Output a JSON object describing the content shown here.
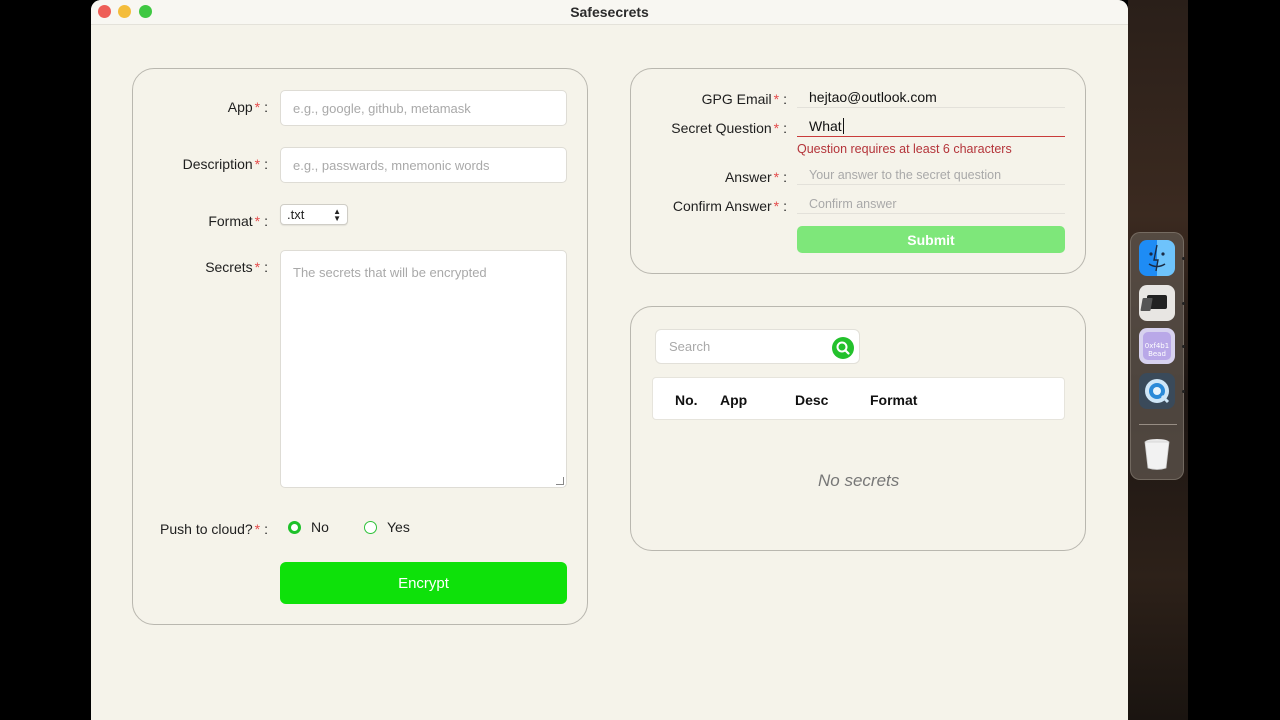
{
  "window": {
    "title": "Safesecrets"
  },
  "encrypt_form": {
    "app": {
      "label": "App",
      "placeholder": "e.g., google, github, metamask"
    },
    "description": {
      "label": "Description",
      "placeholder": "e.g., passwards, mnemonic words"
    },
    "format": {
      "label": "Format",
      "value": ".txt"
    },
    "secrets": {
      "label": "Secrets",
      "placeholder": "The secrets that will be encrypted"
    },
    "push_to_cloud": {
      "label": "Push to cloud?",
      "options": [
        "No",
        "Yes"
      ],
      "selected": "No"
    },
    "required_mark": "*",
    "colon": ":",
    "encrypt_label": "Encrypt"
  },
  "gpg_form": {
    "email": {
      "label": "GPG Email",
      "value": "hejtao@outlook.com"
    },
    "question": {
      "label": "Secret Question",
      "value": "What",
      "error": "Question requires at least 6 characters"
    },
    "answer": {
      "label": "Answer",
      "placeholder": "Your answer to the secret question"
    },
    "confirm": {
      "label": "Confirm Answer",
      "placeholder": "Confirm answer"
    },
    "submit_label": "Submit"
  },
  "secrets_list": {
    "search_placeholder": "Search",
    "columns": [
      "No.",
      "App",
      "Desc",
      "Format"
    ],
    "empty_text": "No secrets"
  },
  "dock": {
    "items": [
      "finder-icon",
      "parallels-icon",
      "bead-icon",
      "quicktime-icon",
      "trash-icon"
    ],
    "bead_text": "0xf4b1\nBead"
  },
  "colors": {
    "accent_green": "#0ee10a",
    "submit_green": "#7ee77a",
    "error_red": "#b4343a",
    "required_red": "#e44b4b"
  }
}
